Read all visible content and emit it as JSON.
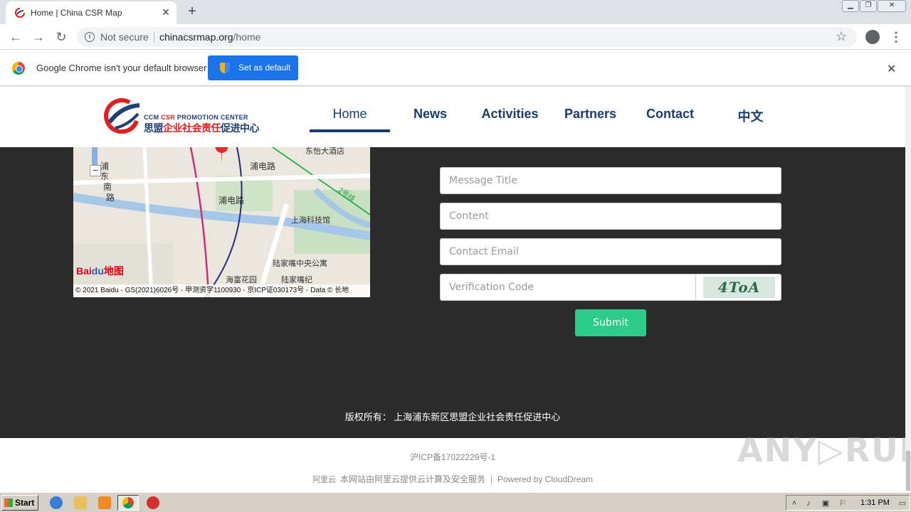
{
  "browser": {
    "tab_title": "Home | China CSR Map",
    "tab_close": "✕",
    "new_tab": "+",
    "not_secure": "Not secure",
    "url_host": "chinacsrmap.org",
    "url_path": "/home",
    "infobar_text": "Google Chrome isn't your default browser",
    "set_default_label": "Set as default",
    "infobar_close": "✕"
  },
  "site": {
    "logo_en_prefix": "CCM ",
    "logo_en_csr": "CSR",
    "logo_en_suffix": " PROMOTION CENTER",
    "logo_cn_prefix": "思盟",
    "logo_cn_main": "企业社会责任",
    "logo_cn_suffix": "促进中心",
    "nav": [
      {
        "label": "Home",
        "active": true
      },
      {
        "label": "News"
      },
      {
        "label": "Activities"
      },
      {
        "label": "Partners"
      },
      {
        "label": "Contact"
      },
      {
        "label": "中文"
      }
    ]
  },
  "map": {
    "labels": [
      "东怡大酒店",
      "浦电路",
      "浦",
      "东",
      "南",
      "路",
      "浦电路",
      "2号线",
      "上海科技馆",
      "陆家嘴中央公寓",
      "海富花园",
      "陆家嘴纪"
    ],
    "zoom_out": "−",
    "baidu_logo": "Bai",
    "baidu_logo_paw": "du",
    "baidu_logo_map": "地图",
    "copyright": "© 2021 Baidu - GS(2021)6026号 - 甲测资字1100930 - 京ICP证030173号 - Data © 长地"
  },
  "form": {
    "title_placeholder": "Message Title",
    "content_placeholder": "Content",
    "email_placeholder": "Contact Email",
    "code_placeholder": "Verification Code",
    "captcha_text": "4ToA",
    "submit_label": "Submit"
  },
  "footer": {
    "rights": "版权所有： 上海浦东新区思盟企业社会责任促进中心",
    "icp": "沪ICP备17022229号-1",
    "aliyun_logo": "阿里云",
    "aliyun_text": "本网站由阿里云提供云计算及安全服务",
    "powered": "Powered by CloudDream",
    "watermark": "ANY▷RUN"
  },
  "taskbar": {
    "start_label": "Start",
    "clock": "1:31 PM"
  }
}
